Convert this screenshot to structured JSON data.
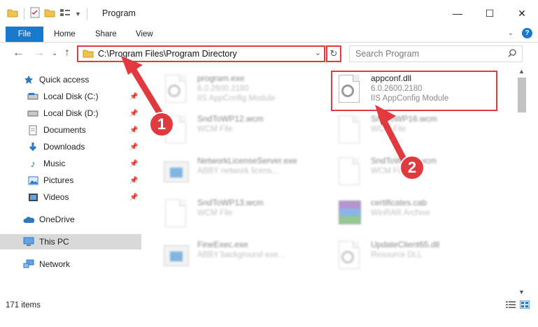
{
  "window": {
    "title": "Program",
    "minimize": "—",
    "maximize": "☐",
    "close": "✕"
  },
  "ribbon": {
    "tabs": [
      "File",
      "Home",
      "Share",
      "View"
    ],
    "help": "?"
  },
  "address": {
    "path": "C:\\Program Files\\Program Directory",
    "search_placeholder": "Search Program"
  },
  "sidebar": {
    "items": [
      {
        "label": "Quick access",
        "icon": "star-icon"
      },
      {
        "label": "Local Disk (C:)",
        "icon": "drive-icon",
        "pinned": true
      },
      {
        "label": "Local Disk (D:)",
        "icon": "drive-icon",
        "pinned": true
      },
      {
        "label": "Documents",
        "icon": "documents-icon",
        "pinned": true
      },
      {
        "label": "Downloads",
        "icon": "download-icon",
        "pinned": true
      },
      {
        "label": "Music",
        "icon": "music-icon",
        "pinned": true
      },
      {
        "label": "Pictures",
        "icon": "pictures-icon",
        "pinned": true
      },
      {
        "label": "Videos",
        "icon": "videos-icon",
        "pinned": true
      },
      {
        "label": "OneDrive",
        "icon": "cloud-icon"
      },
      {
        "label": "This PC",
        "icon": "computer-icon",
        "selected": true
      },
      {
        "label": "Network",
        "icon": "network-icon"
      }
    ]
  },
  "files": [
    {
      "name": "program.exe",
      "line2": "6.0.2600.2180",
      "line3": "IIS AppConfig Module",
      "icon": "exe-icon",
      "faded": true
    },
    {
      "name": "appconf.dll",
      "line2": "6.0.2600.2180",
      "line3": "IIS AppConfig Module",
      "icon": "dll-icon",
      "faded": false
    },
    {
      "name": "SndToWP12.wcm",
      "line2": "WCM File",
      "line3": "",
      "icon": "file-icon",
      "faded": true
    },
    {
      "name": "SndToWP16.wcm",
      "line2": "WCM File",
      "line3": "",
      "icon": "file-icon",
      "faded": true
    },
    {
      "name": "NetworkLicenseServer.exe",
      "line2": "ABBY network licens...",
      "line3": "",
      "icon": "exe-icon",
      "faded": true
    },
    {
      "name": "SndToWP11.wcm",
      "line2": "WCM File",
      "line3": "",
      "icon": "file-icon",
      "faded": true
    },
    {
      "name": "SndToWP13.wcm",
      "line2": "WCM File",
      "line3": "",
      "icon": "file-icon",
      "faded": true
    },
    {
      "name": "certificates.cab",
      "line2": "WinRAR Archive",
      "line3": "",
      "icon": "archive-icon",
      "faded": true
    },
    {
      "name": "FineExec.exe",
      "line2": "ABBY background exe...",
      "line3": "",
      "icon": "exe-icon",
      "faded": true
    },
    {
      "name": "UpdateClient65.dll",
      "line2": "Resource DLL",
      "line3": "",
      "icon": "dll-icon",
      "faded": true
    }
  ],
  "status": {
    "item_count": "171 items"
  },
  "annotations": {
    "step1": "1",
    "step2": "2",
    "color": "#e0393e"
  }
}
